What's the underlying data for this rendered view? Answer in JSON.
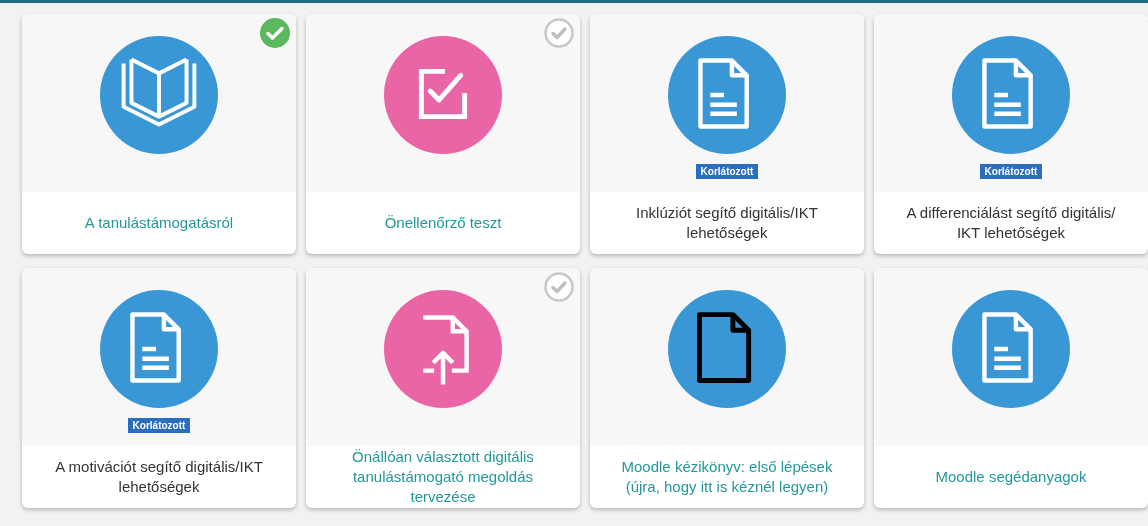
{
  "activities": [
    {
      "kind": "book",
      "label": "A tanulástámogatásról",
      "link": true,
      "completed": true
    },
    {
      "kind": "quiz",
      "label": "Önellenőrző teszt",
      "link": true,
      "completed": false
    },
    {
      "kind": "document",
      "label": "Inklúziót segítő digitális/IKT lehetőségek",
      "link": false,
      "badge": "Korlátozott"
    },
    {
      "kind": "document",
      "label": "A differenciálást segítő digitális/ IKT lehetőségek",
      "link": false,
      "badge": "Korlátozott"
    },
    {
      "kind": "document",
      "label": "A motivációt segítő digitális/IKT lehetőségek",
      "link": false,
      "badge": "Korlátozott"
    },
    {
      "kind": "upload",
      "label": "Önállóan választott digitális tanulástámogató megoldás tervezése",
      "link": true,
      "completed": false
    },
    {
      "kind": "file",
      "label": "Moodle kézikönyv: első lépések (újra, hogy itt is kéznél legyen)",
      "link": true
    },
    {
      "kind": "document",
      "label": "Moodle segédanyagok",
      "link": true
    }
  ]
}
